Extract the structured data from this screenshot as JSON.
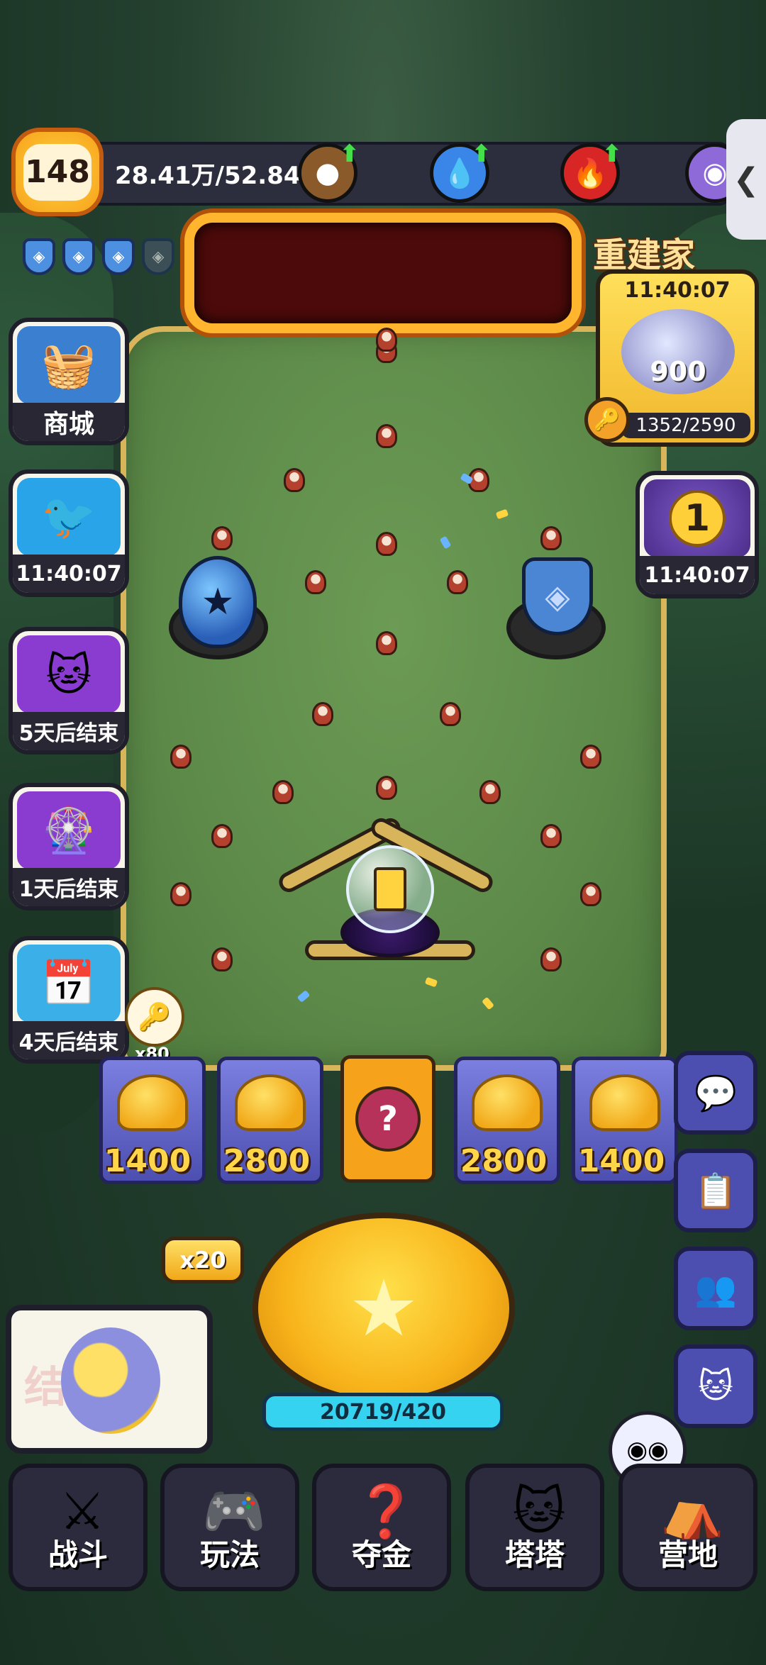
{
  "player": {
    "level": "148",
    "progress_text": "28.41万/52.84万"
  },
  "resources": [
    {
      "icon": "brown-coin-icon",
      "color": "#8a5a2a"
    },
    {
      "icon": "blue-drop-icon",
      "color": "#3a86e8"
    },
    {
      "icon": "red-flame-icon",
      "color": "#d82626"
    },
    {
      "icon": "purple-orb-icon",
      "color": "#8d6ad8"
    }
  ],
  "side_tab": {
    "label": "❮"
  },
  "shields": {
    "active": 3,
    "total": 5
  },
  "left_menu": [
    {
      "label": "商城",
      "icon": "shop-basket-icon",
      "color": "#3b80d0"
    },
    {
      "label": "11:40:07",
      "icon": "bird-event-icon",
      "color": "#29a4e8"
    },
    {
      "label": "5天后结束",
      "icon": "gold-cats-icon",
      "color": "#8a3bd0"
    },
    {
      "label": "1天后结束",
      "icon": "wheel-event-icon",
      "color": "#8a3bd0"
    },
    {
      "label": "4天后结束",
      "icon": "calendar-event-icon",
      "color": "#3bb0e8"
    }
  ],
  "rebuild": {
    "title": "重建家",
    "timer": "11:40:07",
    "reward": "900",
    "progress": "1352/2590"
  },
  "ranking": {
    "rank": "1",
    "timer": "11:40:07"
  },
  "reward_key": {
    "multiplier": "x80"
  },
  "slots": [
    {
      "value": "1400"
    },
    {
      "value": "2800"
    },
    {
      "value": "?"
    },
    {
      "value": "2800"
    },
    {
      "value": "1400"
    }
  ],
  "right_buttons": [
    {
      "icon": "chat-icon"
    },
    {
      "icon": "clipboard-check-icon"
    },
    {
      "icon": "friends-icon"
    },
    {
      "icon": "cat-badge-icon"
    }
  ],
  "launch": {
    "multiplier": "x20",
    "counter": "20719/420"
  },
  "prize": {
    "faded_text": "结束"
  },
  "nav": [
    {
      "label": "战斗",
      "icon": "crossed-swords-icon"
    },
    {
      "label": "玩法",
      "icon": "gamepad-icon"
    },
    {
      "label": "夺金",
      "icon": "mystery-box-icon"
    },
    {
      "label": "塔塔",
      "icon": "robot-cat-icon"
    },
    {
      "label": "营地",
      "icon": "tent-icon"
    }
  ]
}
